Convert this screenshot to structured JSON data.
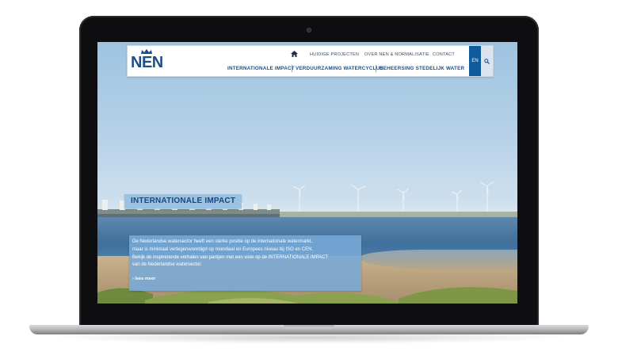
{
  "site": {
    "logo_text": "NEN",
    "top_nav": [
      "HUIDIGE PROJECTEN",
      "OVER NEN & NORMALISATIE",
      "CONTACT"
    ],
    "main_nav": [
      "INTERNATIONALE IMPACT",
      "VERDUURZAMING WATERCYCLUS",
      "BEHEERSING STEDELIJK WATER"
    ],
    "lang_label": "EN",
    "icons": {
      "home": "home-icon",
      "search": "search-icon",
      "logo_crown": "crown-icon"
    }
  },
  "hero": {
    "title": "INTERNATIONALE IMPACT",
    "body_lines": [
      "De Nederlandse watersector heeft een sterke positie op de internationale watermarkt,",
      "maar is minimaal vertegenwoordigd op mondiaal en Europees niveau bij ISO en CEN.",
      "Bekijk de inspirerende verhalen van partijen met een visie op de INTERNATIONALE IMPACT",
      "van de Nederlandse watersector."
    ],
    "read_more": "lees meer"
  },
  "colors": {
    "brand_blue": "#1b4f8a",
    "accent_blue": "#0e5c9b",
    "panel_blue": "#78aad7"
  }
}
